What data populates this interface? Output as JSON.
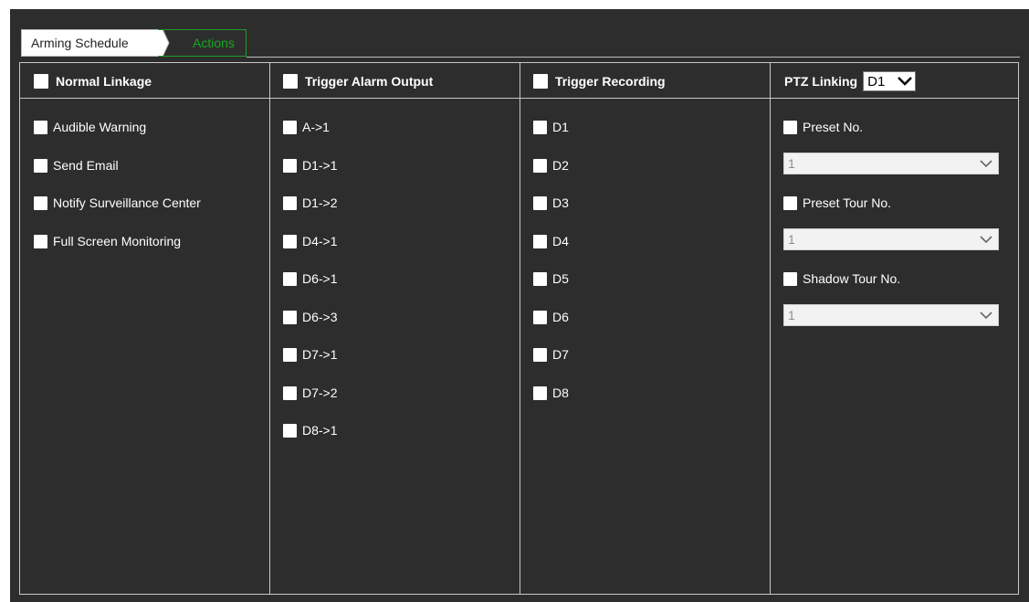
{
  "tabs": {
    "arming_schedule": "Arming Schedule",
    "actions": "Actions"
  },
  "columns": {
    "normal_linkage": {
      "header": "Normal Linkage",
      "items": [
        "Audible Warning",
        "Send Email",
        "Notify Surveillance Center",
        "Full Screen Monitoring"
      ]
    },
    "trigger_alarm_output": {
      "header": "Trigger Alarm Output",
      "items": [
        "A->1",
        "D1->1",
        "D1->2",
        "D4->1",
        "D6->1",
        "D6->3",
        "D7->1",
        "D7->2",
        "D8->1"
      ]
    },
    "trigger_recording": {
      "header": "Trigger Recording",
      "items": [
        "D1",
        "D2",
        "D3",
        "D4",
        "D5",
        "D6",
        "D7",
        "D8"
      ]
    },
    "ptz_linking": {
      "header": "PTZ Linking",
      "channel_value": "D1",
      "preset_label": "Preset No.",
      "preset_value": "1",
      "preset_tour_label": "Preset Tour No.",
      "preset_tour_value": "1",
      "shadow_tour_label": "Shadow Tour No.",
      "shadow_tour_value": "1"
    }
  },
  "colors": {
    "background": "#2d2d2d",
    "active_tab": "#18a81f",
    "border": "#c8c8c8"
  },
  "icons": {
    "dropdown": "chevron-down-icon",
    "checkbox": "checkbox-icon"
  }
}
